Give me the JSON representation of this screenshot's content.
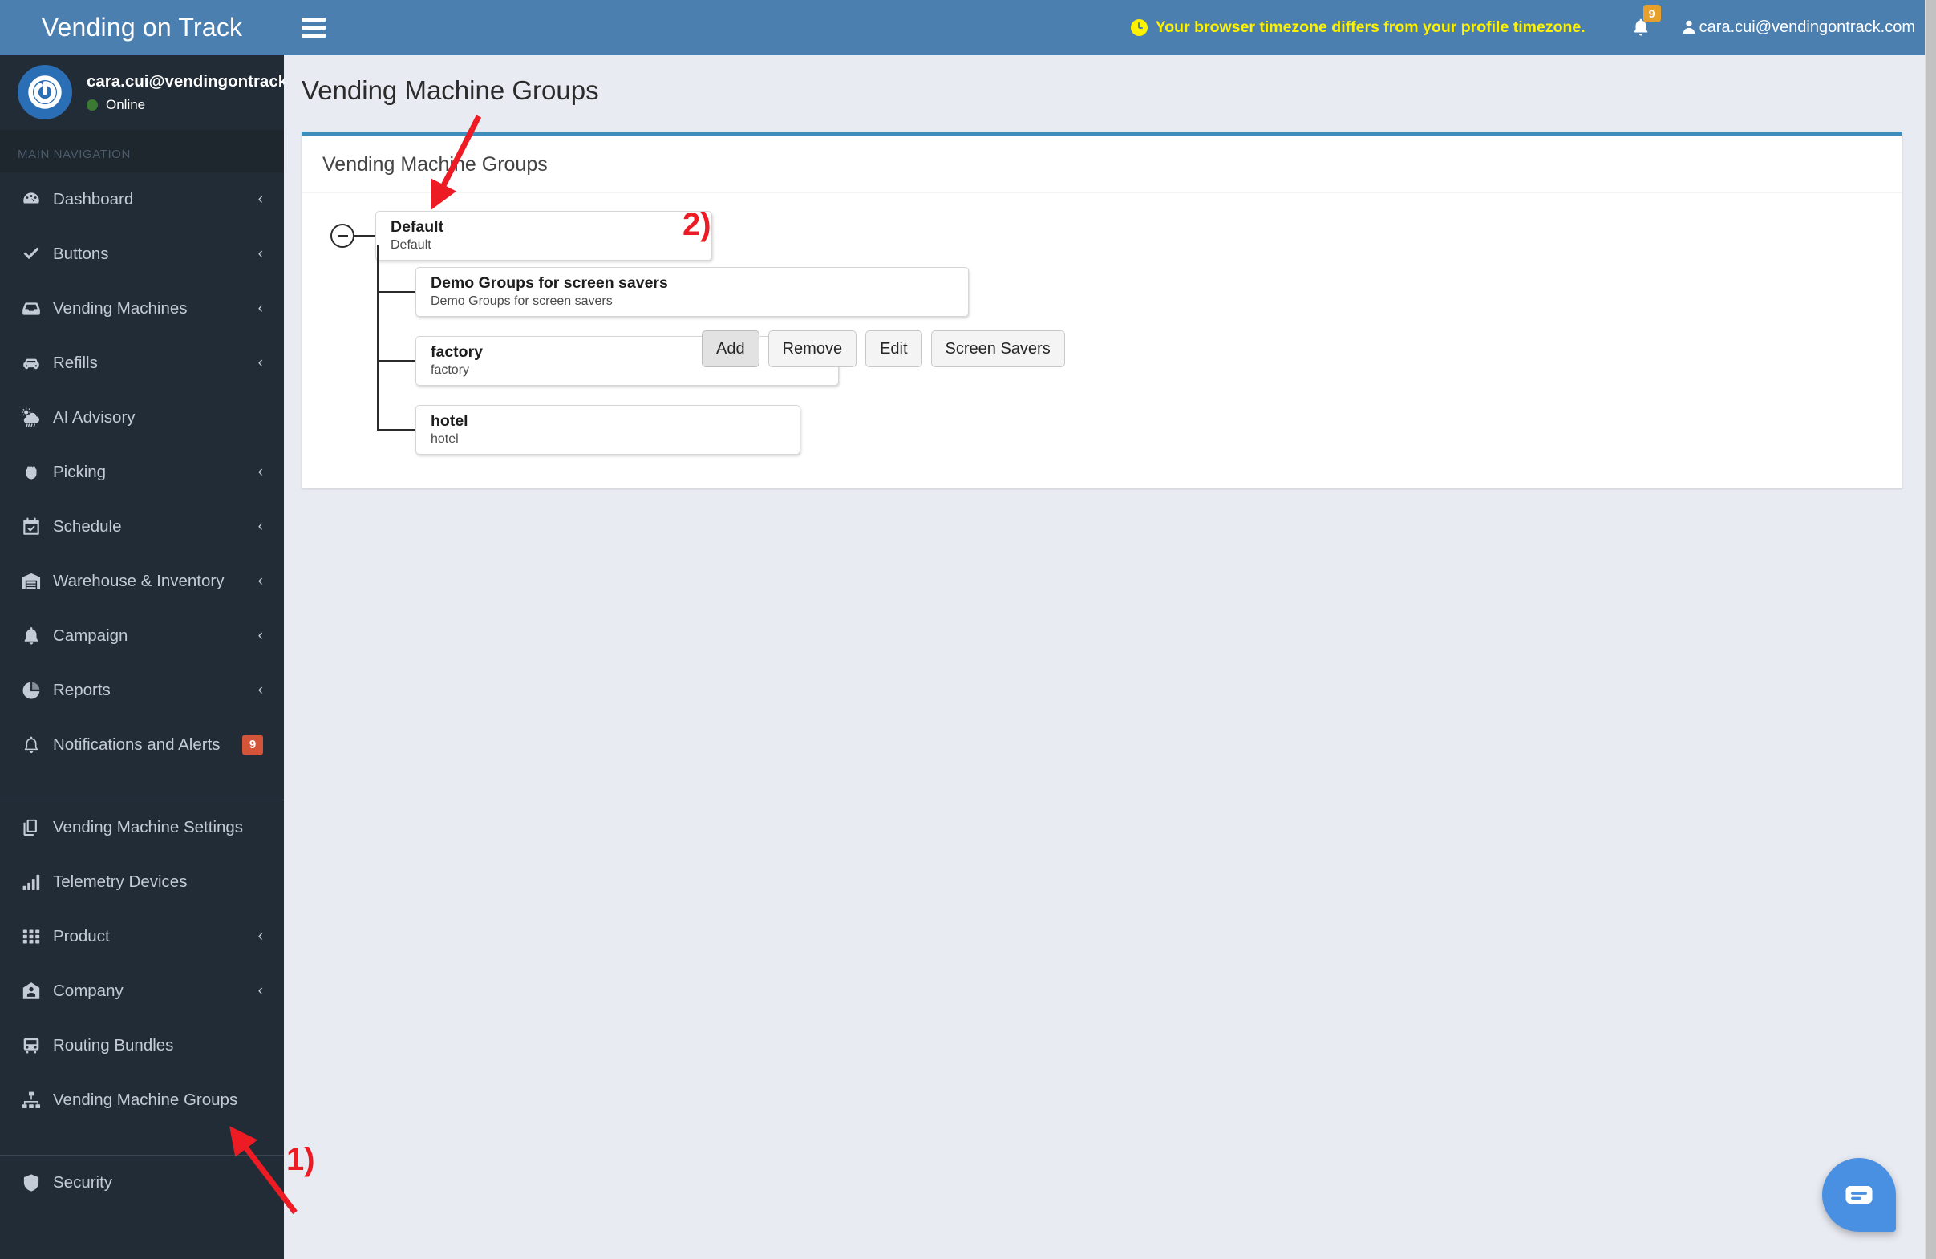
{
  "brand": {
    "title": "Vending on Track"
  },
  "topbar": {
    "menu_toggle_label": "☰",
    "timezone_warning": "Your browser timezone differs from your profile timezone.",
    "notification_count": "9",
    "user_email": "cara.cui@vendingontrack.com"
  },
  "sidebar": {
    "user": {
      "email": "cara.cui@vendingontrack.com",
      "status": "Online"
    },
    "nav_heading": "MAIN NAVIGATION",
    "items": [
      {
        "label": "Dashboard",
        "icon": "dashboard-icon",
        "caret": "‹"
      },
      {
        "label": "Buttons",
        "icon": "check-icon",
        "caret": "‹"
      },
      {
        "label": "Vending Machines",
        "icon": "inbox-icon",
        "caret": "‹"
      },
      {
        "label": "Refills",
        "icon": "car-icon",
        "caret": "‹"
      },
      {
        "label": "AI Advisory",
        "icon": "cloud-sun-rain-icon",
        "caret": ""
      },
      {
        "label": "Picking",
        "icon": "hand-rock-icon",
        "caret": "‹"
      },
      {
        "label": "Schedule",
        "icon": "calendar-check-icon",
        "caret": "‹"
      },
      {
        "label": "Warehouse & Inventory",
        "icon": "warehouse-icon",
        "caret": "‹"
      },
      {
        "label": "Campaign",
        "icon": "bell-filled-icon",
        "caret": "‹"
      },
      {
        "label": "Reports",
        "icon": "pie-chart-icon",
        "caret": "‹"
      },
      {
        "label": "Notifications and Alerts",
        "icon": "bell-outline-icon",
        "caret": "",
        "badge": "9"
      }
    ],
    "items_secondary": [
      {
        "label": "Vending Machine Settings",
        "icon": "copy-icon",
        "caret": ""
      },
      {
        "label": "Telemetry Devices",
        "icon": "signal-icon",
        "caret": ""
      },
      {
        "label": "Product",
        "icon": "grid-icon",
        "caret": "‹"
      },
      {
        "label": "Company",
        "icon": "building-icon",
        "caret": "‹"
      },
      {
        "label": "Routing Bundles",
        "icon": "bus-icon",
        "caret": ""
      },
      {
        "label": "Vending Machine Groups",
        "icon": "sitemap-icon",
        "caret": ""
      }
    ],
    "items_tertiary": [
      {
        "label": "Security",
        "icon": "shield-icon",
        "caret": ""
      }
    ]
  },
  "main": {
    "page_title": "Vending Machine Groups",
    "card_header": "Vending Machine Groups",
    "tree": {
      "root": {
        "title": "Default",
        "subtitle": "Default",
        "toggle_state": "expanded",
        "buttons": [
          {
            "label": "Add",
            "active": true
          },
          {
            "label": "Remove",
            "active": false
          },
          {
            "label": "Edit",
            "active": false
          },
          {
            "label": "Screen Savers",
            "active": false
          }
        ]
      },
      "children": [
        {
          "title": "Demo Groups for screen savers",
          "subtitle": "Demo Groups for screen savers"
        },
        {
          "title": "factory",
          "subtitle": "factory"
        },
        {
          "title": "hotel",
          "subtitle": "hotel"
        }
      ]
    }
  },
  "annotations": [
    {
      "id": "1",
      "label": "1)"
    },
    {
      "id": "2",
      "label": "2)"
    }
  ],
  "colors": {
    "header_blue": "#4a7fb0",
    "sidebar_dark": "#222c36",
    "content_bg": "#E8EBF2",
    "card_accent": "#3c8dbc",
    "warning_yellow": "#FFF200",
    "badge_orange": "#E8A02C",
    "badge_red": "#d4543a",
    "annotation_red": "#ED1C24",
    "chat_blue": "#4a90e2",
    "online_green": "#3b7a32"
  }
}
